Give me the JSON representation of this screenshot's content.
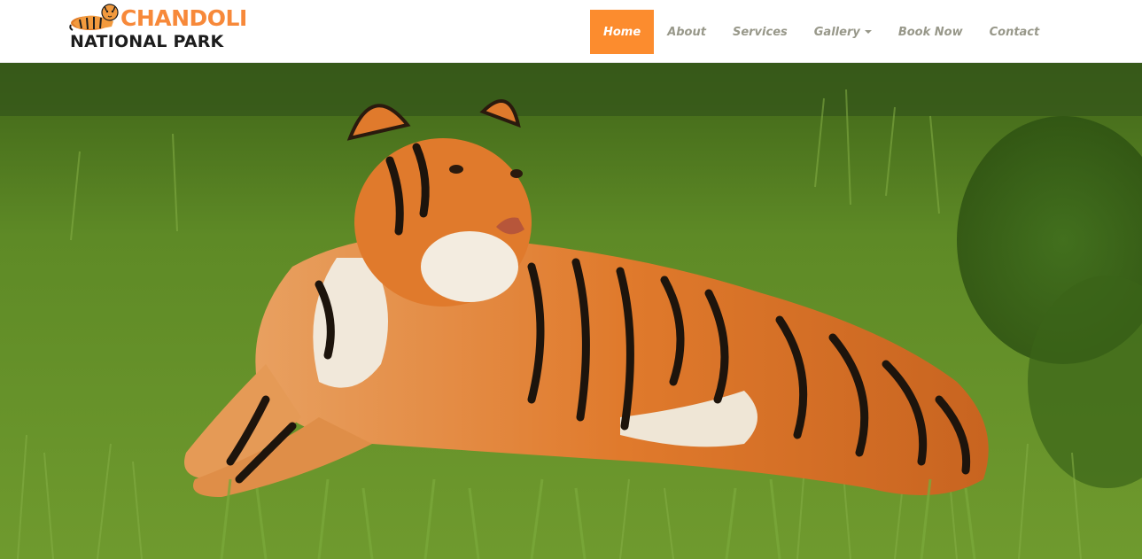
{
  "brand": {
    "line1": "CHANDOLI",
    "line2": "NATIONAL PARK",
    "logo_icon": "tiger-icon",
    "accent_color": "#f7893a"
  },
  "nav": {
    "items": [
      {
        "label": "Home",
        "active": true
      },
      {
        "label": "About",
        "active": false
      },
      {
        "label": "Services",
        "active": false
      },
      {
        "label": "Gallery",
        "active": false,
        "dropdown": true
      },
      {
        "label": "Book Now",
        "active": false
      },
      {
        "label": "Contact",
        "active": false
      }
    ],
    "active_color": "#fc8c2e",
    "text_color": "#98988a"
  },
  "hero": {
    "subject": "tiger lying in green grass",
    "background_color": "#4f7a22"
  }
}
